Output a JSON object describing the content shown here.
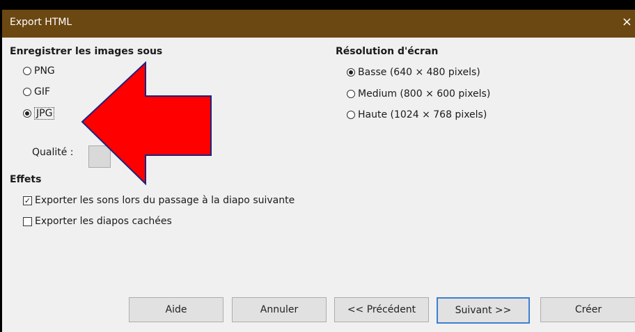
{
  "window": {
    "title": "Export HTML",
    "close_glyph": "×"
  },
  "images": {
    "heading": "Enregistrer les images sous",
    "options": [
      "PNG",
      "GIF",
      "JPG"
    ],
    "selected": "JPG",
    "quality_label": "Qualité :"
  },
  "resolution": {
    "heading": "Résolution d'écran",
    "options": [
      "Basse (640 × 480 pixels)",
      "Medium (800 × 600 pixels)",
      "Haute (1024 × 768 pixels)"
    ],
    "selected": "Basse (640 × 480 pixels)"
  },
  "effects": {
    "heading": "Effets",
    "check_sounds": "Exporter les sons lors du passage à la diapo suivante",
    "check_sounds_checked": true,
    "check_hidden": "Exporter les diapos cachées",
    "check_hidden_checked": false
  },
  "buttons": {
    "help": "Aide",
    "cancel": "Annuler",
    "previous": "<< Précédent",
    "next": "Suivant >>",
    "create": "Créer"
  },
  "annotation": {
    "arrow_color": "#ff0000",
    "arrow_outline": "#1a237e"
  }
}
